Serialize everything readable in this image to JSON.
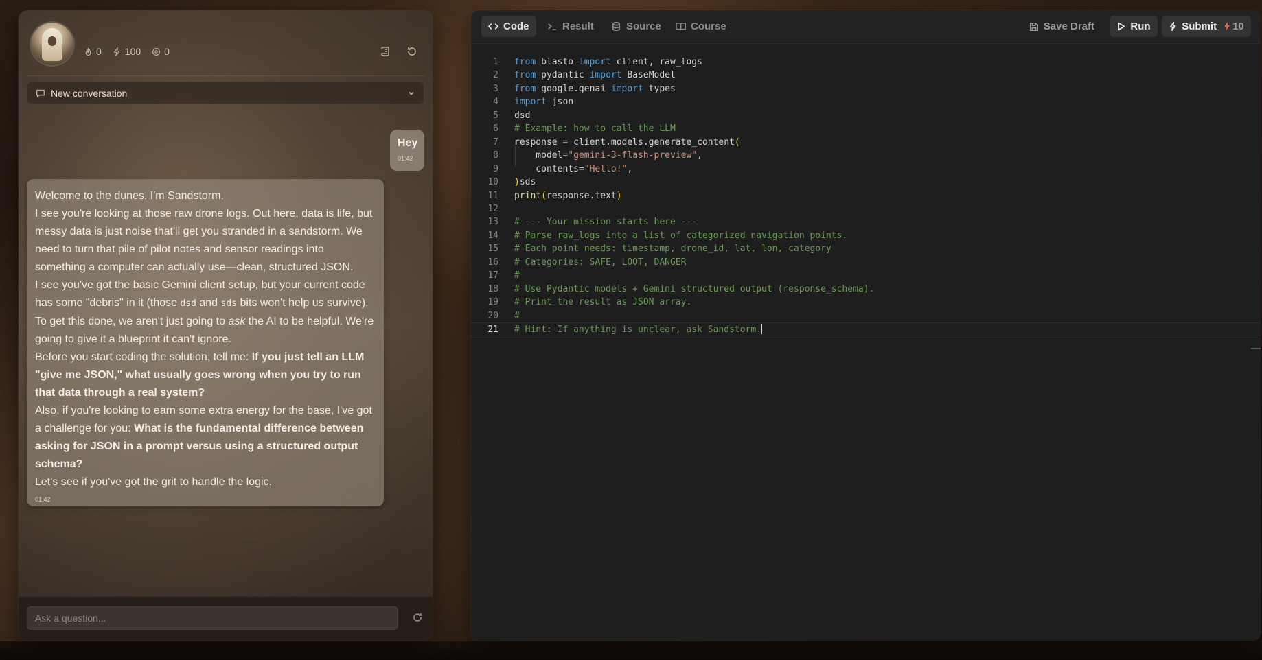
{
  "chat": {
    "stats": {
      "streak": "0",
      "energy": "100",
      "gems": "0"
    },
    "conversation_select": "New conversation",
    "user_message": {
      "text": "Hey",
      "time": "01:42"
    },
    "bot_message": {
      "p1": "Welcome to the dunes. I'm Sandstorm.",
      "p2": "I see you're looking at those raw drone logs. Out here, data is life, but messy data is just noise that'll get you stranded in a sandstorm. We need to turn that pile of pilot notes and sensor readings into something a computer can actually use—clean, structured JSON.",
      "p3_a": "I see you've got the basic Gemini client setup, but your current code has some \"debris\" in it (those ",
      "p3_code1": "dsd",
      "p3_b": " and ",
      "p3_code2": "sds",
      "p3_c": " bits won't help us survive). To get this done, we aren't just going to ",
      "p3_em": "ask",
      "p3_d": " the AI to be helpful. We're going to give it a blueprint it can't ignore.",
      "p4_a": "Before you start coding the solution, tell me: ",
      "p4_bold": "If you just tell an LLM \"give me JSON,\" what usually goes wrong when you try to run that data through a real system?",
      "p5_a": "Also, if you're looking to earn some extra energy for the base, I've got a challenge for you: ",
      "p5_bold": "What is the fundamental difference between asking for JSON in a prompt versus using a structured output schema?",
      "p6": "Let's see if you've got the grit to handle the logic.",
      "time": "01:42"
    },
    "input_placeholder": "Ask a question..."
  },
  "editor": {
    "tabs": {
      "code": "Code",
      "result": "Result",
      "source": "Source",
      "course": "Course"
    },
    "save_draft": "Save Draft",
    "run": "Run",
    "submit": "Submit",
    "submit_cost": "10",
    "lines": [
      {
        "n": "1",
        "tokens": [
          {
            "t": "kw",
            "v": "from"
          },
          {
            "t": "",
            "v": " blasto "
          },
          {
            "t": "kw",
            "v": "import"
          },
          {
            "t": "",
            "v": " client, raw_logs"
          }
        ]
      },
      {
        "n": "2",
        "tokens": [
          {
            "t": "kw",
            "v": "from"
          },
          {
            "t": "",
            "v": " pydantic "
          },
          {
            "t": "kw",
            "v": "import"
          },
          {
            "t": "",
            "v": " BaseModel"
          }
        ]
      },
      {
        "n": "3",
        "tokens": [
          {
            "t": "kw",
            "v": "from"
          },
          {
            "t": "",
            "v": " google.genai "
          },
          {
            "t": "kw",
            "v": "import"
          },
          {
            "t": "",
            "v": " types"
          }
        ]
      },
      {
        "n": "4",
        "tokens": [
          {
            "t": "kw",
            "v": "import"
          },
          {
            "t": "",
            "v": " json"
          }
        ]
      },
      {
        "n": "5",
        "tokens": [
          {
            "t": "",
            "v": "dsd"
          }
        ]
      },
      {
        "n": "6",
        "tokens": [
          {
            "t": "cm",
            "v": "# Example: how to call the LLM"
          }
        ]
      },
      {
        "n": "7",
        "tokens": [
          {
            "t": "",
            "v": "response = client.models.generate_content"
          },
          {
            "t": "paren",
            "v": "("
          }
        ]
      },
      {
        "n": "8",
        "tokens": [
          {
            "t": "",
            "v": "    model="
          },
          {
            "t": "str",
            "v": "\"gemini-3-flash-preview\""
          },
          {
            "t": "",
            "v": ","
          }
        ]
      },
      {
        "n": "9",
        "tokens": [
          {
            "t": "",
            "v": "    contents="
          },
          {
            "t": "str",
            "v": "\"Hello!\""
          },
          {
            "t": "",
            "v": ","
          }
        ]
      },
      {
        "n": "10",
        "tokens": [
          {
            "t": "paren",
            "v": ")"
          },
          {
            "t": "",
            "v": "sds"
          }
        ]
      },
      {
        "n": "11",
        "tokens": [
          {
            "t": "fn",
            "v": "print"
          },
          {
            "t": "paren",
            "v": "("
          },
          {
            "t": "",
            "v": "response.text"
          },
          {
            "t": "paren",
            "v": ")"
          }
        ]
      },
      {
        "n": "12",
        "tokens": []
      },
      {
        "n": "13",
        "tokens": [
          {
            "t": "cm",
            "v": "# --- Your mission starts here ---"
          }
        ]
      },
      {
        "n": "14",
        "tokens": [
          {
            "t": "cm",
            "v": "# Parse raw_logs into a list of categorized navigation points."
          }
        ]
      },
      {
        "n": "15",
        "tokens": [
          {
            "t": "cm",
            "v": "# Each point needs: timestamp, drone_id, lat, lon, category"
          }
        ]
      },
      {
        "n": "16",
        "tokens": [
          {
            "t": "cm",
            "v": "# Categories: SAFE, LOOT, DANGER"
          }
        ]
      },
      {
        "n": "17",
        "tokens": [
          {
            "t": "cm",
            "v": "#"
          }
        ]
      },
      {
        "n": "18",
        "tokens": [
          {
            "t": "cm",
            "v": "# Use Pydantic models + Gemini structured output (response_schema)."
          }
        ]
      },
      {
        "n": "19",
        "tokens": [
          {
            "t": "cm",
            "v": "# Print the result as JSON array."
          }
        ]
      },
      {
        "n": "20",
        "tokens": [
          {
            "t": "cm",
            "v": "#"
          }
        ]
      },
      {
        "n": "21",
        "tokens": [
          {
            "t": "cm",
            "v": "# Hint: If anything is unclear, ask Sandstorm."
          }
        ],
        "current": true
      }
    ]
  }
}
